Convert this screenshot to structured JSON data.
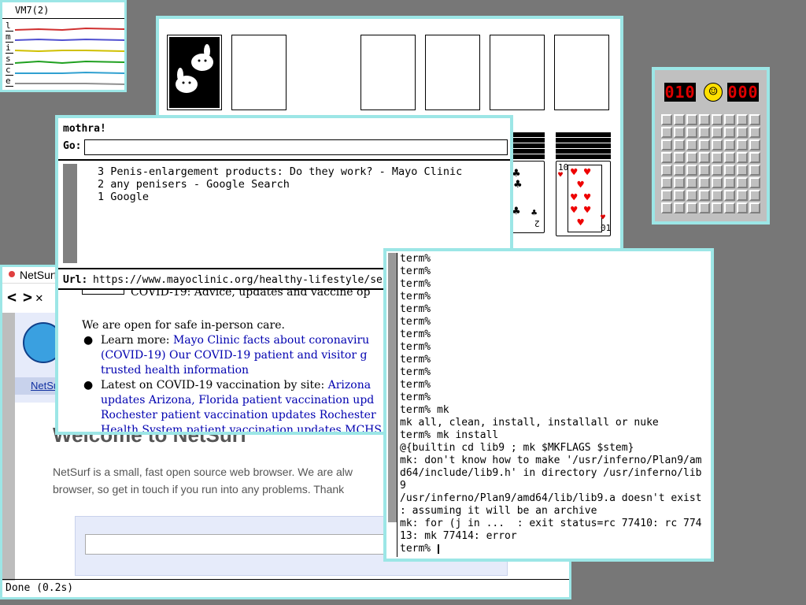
{
  "stats": {
    "title": "VM7(2)",
    "labels": [
      "l",
      "m",
      "i",
      "s",
      "c",
      "e"
    ],
    "colors": [
      "#d03030",
      "#5050d0",
      "#d0c000",
      "#20a020",
      "#30a0d0",
      "#909090"
    ]
  },
  "solitaire": {
    "top_card": "10",
    "bottom_rank": "2",
    "bottom_rank2": "01"
  },
  "minesweeper": {
    "mines_left": "010",
    "timer": "000",
    "face": "☺"
  },
  "netsurf": {
    "title": "NetSurf",
    "nav_back": "<",
    "nav_forward": ">",
    "tab_label": "NetSurf",
    "heading": "Welcome to NetSurf",
    "para1": "NetSurf is a small, fast open source web browser. We are alw",
    "para2": "browser, so get in touch if you run into any problems. Thank",
    "status": "Done (0.2s)"
  },
  "mothra": {
    "title": "mothra!",
    "go_label": "Go:",
    "go_value": "",
    "history": [
      "3 Penis-enlargement products: Do they work? - Mayo Clinic",
      "2 any penisers - Google Search",
      "1 Google"
    ],
    "url_label": "Url:",
    "url_value": "https://www.mayoclinic.org/healthy-lifestyle/se",
    "covid_clipped": "COVID-19: Advice, updates and vaccine op",
    "open_text": "We are open for safe in-person care.",
    "b1_lead": "Learn more:",
    "b1_link1": "Mayo Clinic facts about coronaviru",
    "b1_link2": "(COVID-19) Our COVID-19 patient and visitor g",
    "b1_link3": "trusted health information",
    "b2_lead": "Latest on COVID-19 vaccination by site:",
    "b2_link1": "Arizona",
    "b2_link2": "updates Arizona,",
    "b2_link3": "Florida patient vaccination upd",
    "b2_link4": "Rochester patient vaccination updates Rochester",
    "b2_link5": "Health System patient vaccination updates MCHS"
  },
  "terminal": {
    "lines": [
      "term%",
      "term%",
      "term%",
      "term%",
      "term%",
      "term%",
      "term%",
      "term%",
      "term%",
      "term%",
      "term%",
      "term%",
      "term% mk",
      "mk all, clean, install, installall or nuke",
      "term% mk install",
      "@{builtin cd lib9 ; mk $MKFLAGS $stem}",
      "mk: don't know how to make '/usr/inferno/Plan9/am",
      "d64/include/lib9.h' in directory /usr/inferno/lib",
      "9",
      "/usr/inferno/Plan9/amd64/lib/lib9.a doesn't exist",
      ": assuming it will be an archive",
      "mk: for (j in ...  : exit status=rc 77410: rc 774",
      "13: mk 77414: error",
      "term% "
    ]
  }
}
